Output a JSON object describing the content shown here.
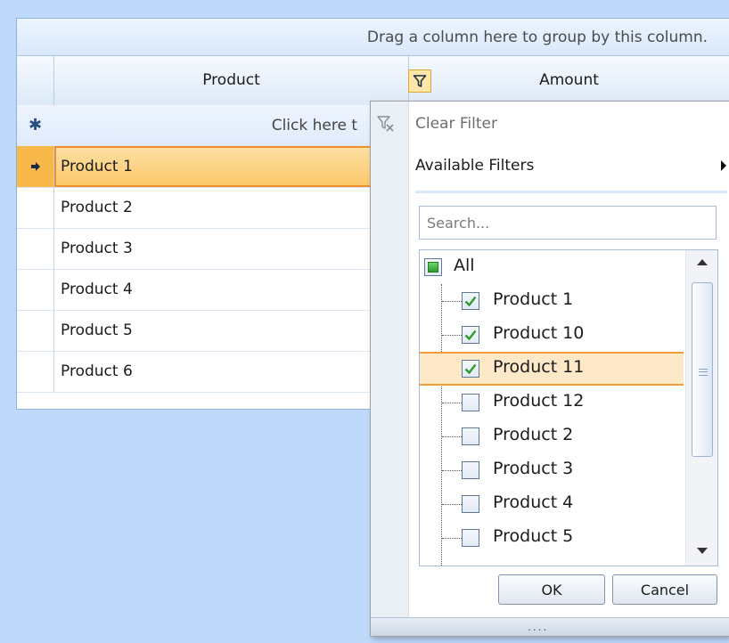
{
  "grid": {
    "group_panel_text": "Drag a column here to group by this column.",
    "columns": [
      "Product",
      "Amount"
    ],
    "new_row_text": "Click here t",
    "rows": [
      "Product 1",
      "Product 2",
      "Product 3",
      "Product 4",
      "Product 5",
      "Product 6"
    ],
    "selected_row": "Product 1"
  },
  "filter_popup": {
    "clear_filter_label": "Clear Filter",
    "available_filters_label": "Available Filters",
    "search_placeholder": "Search...",
    "items": [
      {
        "label": "All",
        "state": "indeterminate"
      },
      {
        "label": "Product 1",
        "state": "checked"
      },
      {
        "label": "Product 10",
        "state": "checked"
      },
      {
        "label": "Product 11",
        "state": "checked",
        "highlighted": true
      },
      {
        "label": "Product 12",
        "state": "unchecked"
      },
      {
        "label": "Product 2",
        "state": "unchecked"
      },
      {
        "label": "Product 3",
        "state": "unchecked"
      },
      {
        "label": "Product 4",
        "state": "unchecked"
      },
      {
        "label": "Product 5",
        "state": "unchecked"
      }
    ],
    "ok_label": "OK",
    "cancel_label": "Cancel",
    "resize_grip": "...."
  },
  "colors": {
    "background": "#bfd9fb",
    "selected_row": "#fcc767",
    "selected_border": "#f08e2b",
    "check_green": "#2e9c2e"
  }
}
